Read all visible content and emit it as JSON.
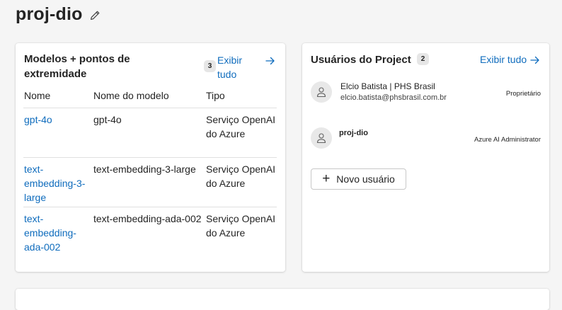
{
  "page": {
    "title": "proj-dio"
  },
  "models_card": {
    "title": "Modelos + pontos de extremidade",
    "count": "3",
    "view_all": "Exibir tudo",
    "columns": {
      "name": "Nome",
      "model": "Nome do modelo",
      "type": "Tipo"
    },
    "rows": [
      {
        "name": "gpt-4o",
        "model": "gpt-4o",
        "type": "Serviço OpenAI do Azure"
      },
      {
        "name": "text-embedding-3-large",
        "model": "text-embedding-3-large",
        "type": "Serviço OpenAI do Azure"
      },
      {
        "name": "text-embedding-ada-002",
        "model": "text-embedding-ada-002",
        "type": "Serviço OpenAI do Azure"
      }
    ]
  },
  "users_card": {
    "title": "Usuários do Project",
    "count": "2",
    "view_all": "Exibir tudo",
    "users": [
      {
        "name": "Elcio Batista | PHS Brasil",
        "email": "elcio.batista@phsbrasil.com.br",
        "role": "Proprietário"
      },
      {
        "name": "proj-dio",
        "email": "",
        "role": "Azure AI Administrator"
      }
    ],
    "new_user_label": "Novo usuário"
  },
  "colors": {
    "link": "#0f6cbd",
    "background": "#f5f5f5",
    "card": "#ffffff",
    "badge": "#e6e6e6"
  },
  "icons": {
    "edit": "pencil-icon",
    "arrow": "arrow-right-icon",
    "avatar": "person-icon",
    "add": "plus-icon"
  }
}
